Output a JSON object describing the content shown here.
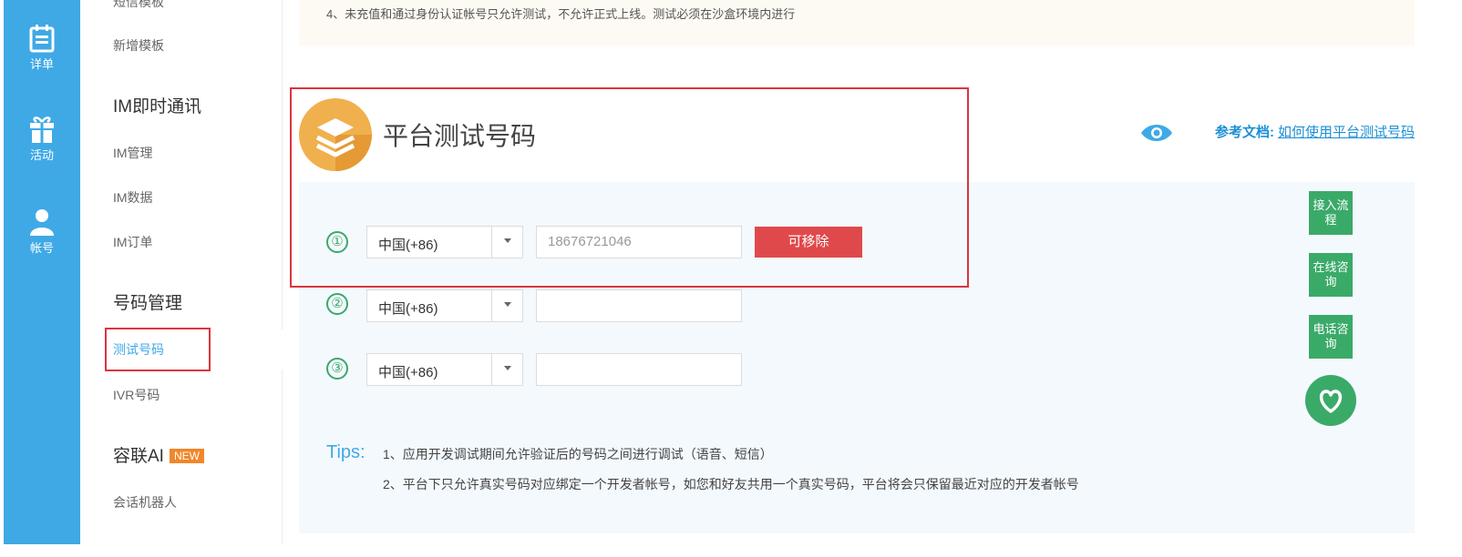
{
  "rail": {
    "items": [
      {
        "label": "详单",
        "icon": "list-icon"
      },
      {
        "label": "活动",
        "icon": "gift-icon"
      },
      {
        "label": "帐号",
        "icon": "user-icon"
      }
    ]
  },
  "subnav": {
    "top_cut": "短信模板",
    "new_template": "新增模板",
    "im_heading": "IM即时通讯",
    "im_manage": "IM管理",
    "im_data": "IM数据",
    "im_order": "IM订单",
    "num_heading": "号码管理",
    "test_number": "测试号码",
    "ivr_number": "IVR号码",
    "ai_heading": "容联AI",
    "ai_badge": "NEW",
    "chatbot": "会话机器人"
  },
  "notice": {
    "text": "4、未充值和通过身份认证帐号只允许测试，不允许正式上线。测试必须在沙盒环境内进行"
  },
  "header": {
    "title": "平台测试号码",
    "ref_label": "参考文档:",
    "ref_link": "如何使用平台测试号码"
  },
  "rows": [
    {
      "num": "①",
      "country": "中国(+86)",
      "phone": "18676721046",
      "action": "可移除"
    },
    {
      "num": "②",
      "country": "中国(+86)",
      "phone": ""
    },
    {
      "num": "③",
      "country": "中国(+86)",
      "phone": ""
    }
  ],
  "tips": {
    "label": "Tips:",
    "line1": "1、应用开发调试期间允许验证后的号码之间进行调试（语音、短信）",
    "line2": "2、平台下只允许真实号码对应绑定一个开发者帐号，如您和好友共用一个真实号码，平台将会只保留最近对应的开发者帐号"
  },
  "side_tools": {
    "access": "接入流程",
    "online": "在线咨询",
    "phone": "电话咨询"
  },
  "colors": {
    "rail": "#3fa9e6",
    "accent_green": "#3aaa69",
    "danger": "#e0494b",
    "highlight": "#d9363e",
    "logo": "#f0b04e"
  }
}
